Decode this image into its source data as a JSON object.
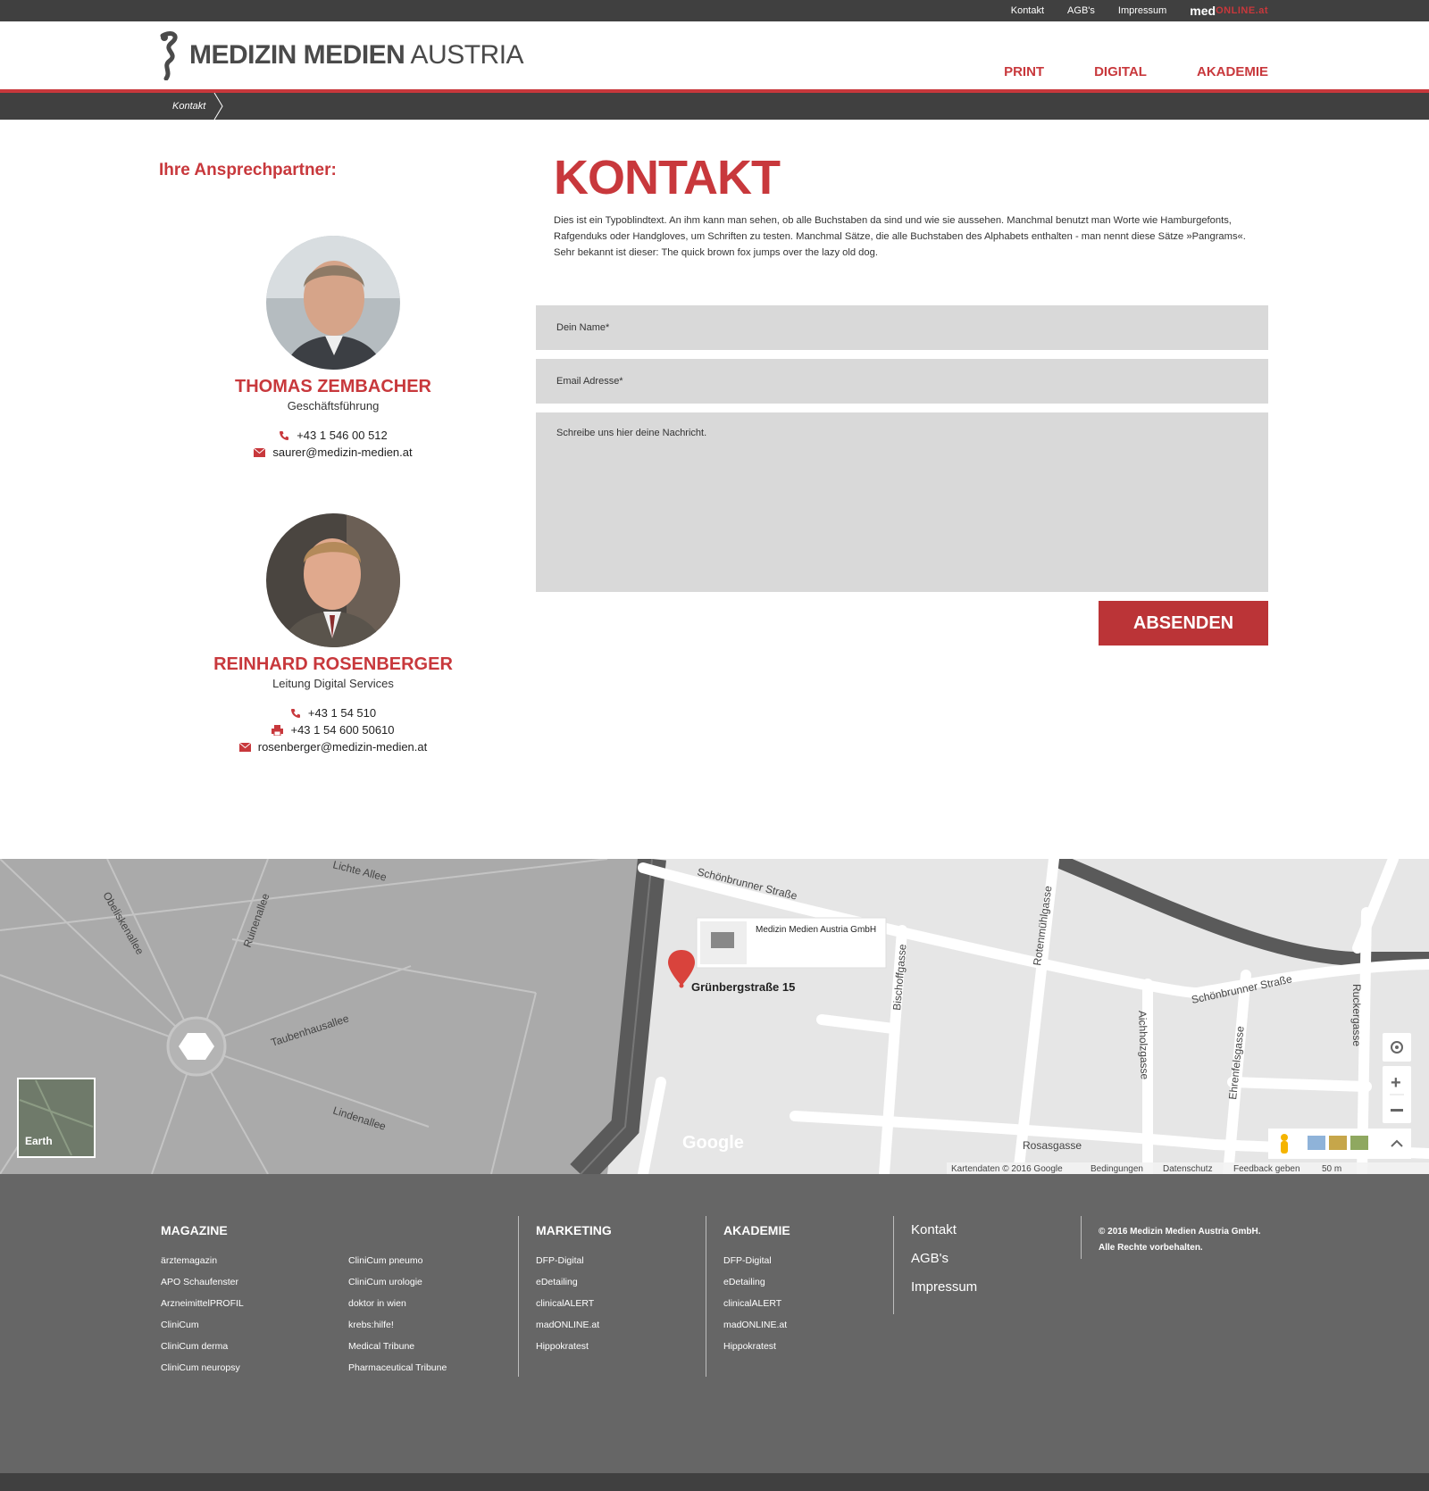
{
  "topbar": {
    "links": [
      "Kontakt",
      "AGB's",
      "Impressum"
    ],
    "brand_main": "med",
    "brand_accent": "ONLINE.at"
  },
  "header": {
    "logo_bold": "MEDIZIN MEDIEN",
    "logo_light": "AUSTRIA",
    "nav": [
      "PRINT",
      "DIGITAL",
      "AKADEMIE"
    ]
  },
  "breadcrumb": {
    "current": "Kontakt"
  },
  "contacts": {
    "heading": "Ihre Ansprechpartner:",
    "people": [
      {
        "name": "THOMAS ZEMBACHER",
        "role": "Geschäftsführung",
        "phone": "+43 1 546 00 512",
        "email": "saurer@medizin-medien.at"
      },
      {
        "name": "REINHARD ROSENBERGER",
        "role": "Leitung Digital Services",
        "phone": "+43 1 54 510",
        "fax": "+43 1 54 600 50610",
        "email": "rosenberger@medizin-medien.at"
      }
    ]
  },
  "main": {
    "title": "KONTAKT",
    "intro": "Dies ist ein Typoblindtext. An ihm kann man sehen, ob alle Buchstaben da sind und wie sie aussehen. Manchmal benutzt man Worte wie Hamburgefonts, Rafgenduks oder Handgloves, um Schriften zu testen. Manchmal Sätze, die alle Buchstaben des Alphabets enthalten - man nennt diese Sätze »Pangrams«. Sehr bekannt ist dieser: The quick brown fox jumps over the lazy old dog."
  },
  "form": {
    "name_placeholder": "Dein Name*",
    "email_placeholder": "Email Adresse*",
    "message_placeholder": "Schreibe uns hier deine Nachricht.",
    "submit_label": "ABSENDEN"
  },
  "map": {
    "place_name": "Medizin Medien Austria GmbH",
    "address": "Grünbergstraße 15",
    "earth_label": "Earth",
    "streets": [
      "Schönbrunner Straße",
      "Schönbrunner Straße",
      "Rotenmühlgasse",
      "Bischoffgasse",
      "Aichholzgasse",
      "Ehrenfelsgasse",
      "Ruckergasse",
      "Rosasgasse",
      "Obeliskenallee",
      "Ruinenallee",
      "Taubenhausallee",
      "Lindenallee",
      "Lichte Allee"
    ],
    "attribution": [
      "Kartendaten © 2016 Google",
      "Bedingungen",
      "Datenschutz",
      "Feedback geben",
      "50 m"
    ],
    "logo": "Google"
  },
  "footer": {
    "magazine": {
      "title": "MAGAZINE",
      "col1": [
        "ärztemagazin",
        "APO Schaufenster",
        "ArzneimittelPROFIL",
        "CliniCum",
        "CliniCum derma",
        "CliniCum neuropsy"
      ],
      "col2": [
        "CliniCum pneumo",
        "CliniCum urologie",
        "doktor in wien",
        "krebs:hilfe!",
        "Medical Tribune",
        "Pharmaceutical Tribune"
      ]
    },
    "marketing": {
      "title": "MARKETING",
      "items": [
        "DFP-Digital",
        "eDetailing",
        "clinicalALERT",
        "madONLINE.at",
        "Hippokratest"
      ]
    },
    "akademie": {
      "title": "AKADEMIE",
      "items": [
        "DFP-Digital",
        "eDetailing",
        "clinicalALERT",
        "madONLINE.at",
        "Hippokratest"
      ]
    },
    "links": [
      "Kontakt",
      "AGB's",
      "Impressum"
    ],
    "copyright_1": "© 2016 Medizin Medien Austria GmbH.",
    "copyright_2": "Alle Rechte vorbehalten."
  },
  "colors": {
    "accent": "#c8383c",
    "dark_bar": "#404040",
    "footer_bg": "#666666",
    "field_bg": "#d9d9d9"
  }
}
